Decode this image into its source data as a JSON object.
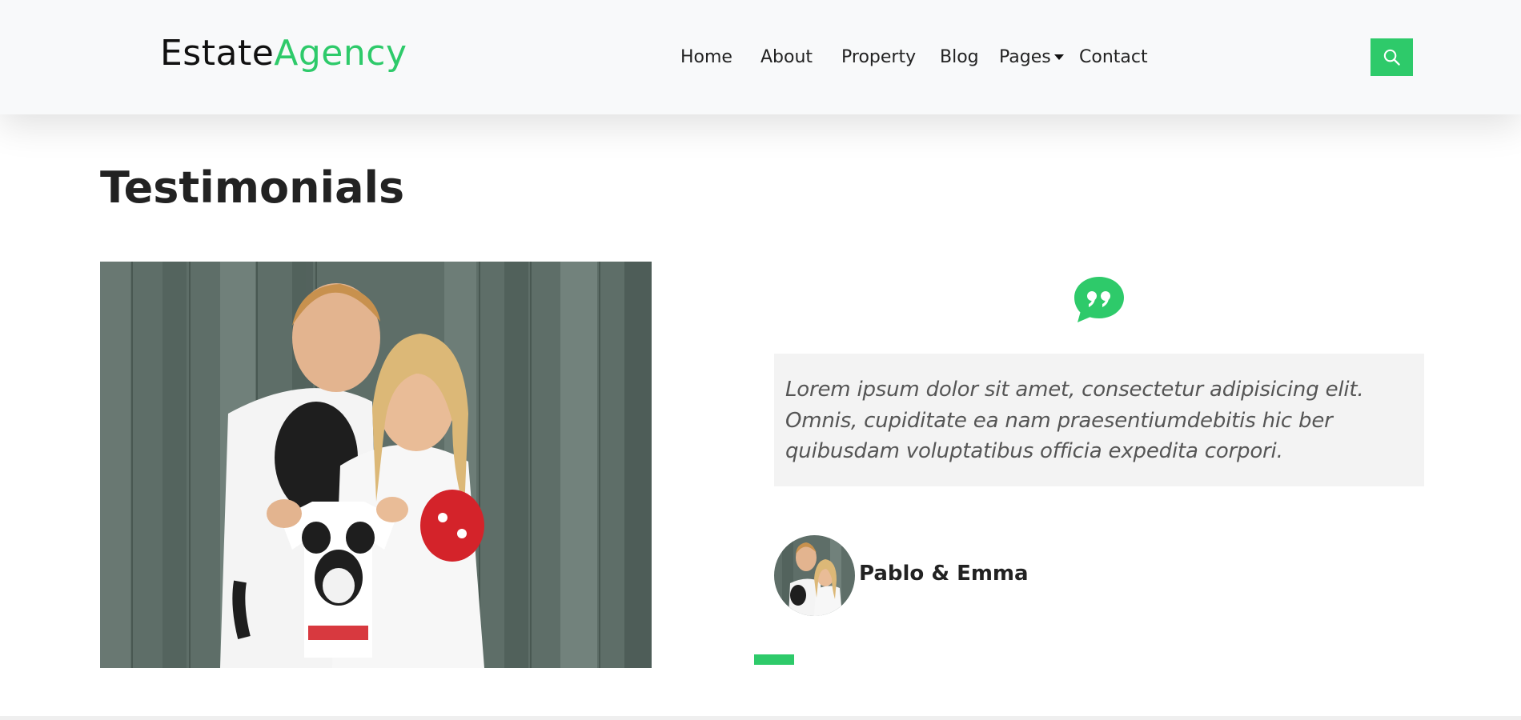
{
  "brand": {
    "part1": "Estate",
    "part2": "Agency"
  },
  "nav": {
    "items": [
      {
        "label": "Home"
      },
      {
        "label": "About"
      },
      {
        "label": "Property"
      },
      {
        "label": "Blog"
      },
      {
        "label": "Pages"
      },
      {
        "label": "Contact"
      }
    ],
    "search_icon": "search-icon"
  },
  "section": {
    "title": "Testimonials"
  },
  "testimonial": {
    "quote_icon": "quote-icon",
    "text": "Lorem ipsum dolor sit amet, consectetur adipisicing elit. Omnis, cupiditate ea nam praesentiumdebitis hic ber quibusdam voluptatibus officia expedita corpori.",
    "author": "Pablo & Emma"
  },
  "colors": {
    "accent": "#2eca6a",
    "text": "#222222",
    "quote_bg": "#f3f3f3",
    "navbar_bg": "#f8f9fa"
  }
}
